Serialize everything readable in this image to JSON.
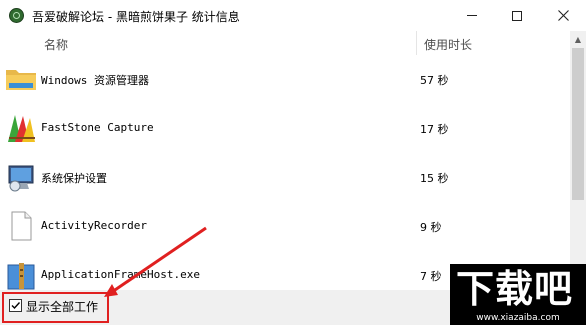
{
  "window": {
    "title": "吾爱破解论坛 - 黑暗煎饼果子   统计信息",
    "minimize": "—",
    "maximize": "□",
    "close": "✕"
  },
  "list": {
    "columns": {
      "name": "名称",
      "time": "使用时长"
    },
    "rows": [
      {
        "name": "Windows 资源管理器",
        "time": "57 秒",
        "icon": "folder-icon"
      },
      {
        "name": "FastStone Capture",
        "time": "17 秒",
        "icon": "faststone-icon"
      },
      {
        "name": "系统保护设置",
        "time": "15 秒",
        "icon": "system-protection-icon"
      },
      {
        "name": "ActivityRecorder",
        "time": "9 秒",
        "icon": "blank-file-icon"
      },
      {
        "name": "ApplicationFrameHost.exe",
        "time": "7 秒",
        "icon": "app-frame-icon"
      }
    ]
  },
  "footer": {
    "show_all_checkbox": {
      "label": "显示全部工作",
      "checked": true
    }
  },
  "watermark": {
    "big": "下载吧",
    "small": "www.xiazaiba.com"
  },
  "colors": {
    "annotation_red": "#e02020",
    "footer_bg": "#f0f0f0"
  }
}
